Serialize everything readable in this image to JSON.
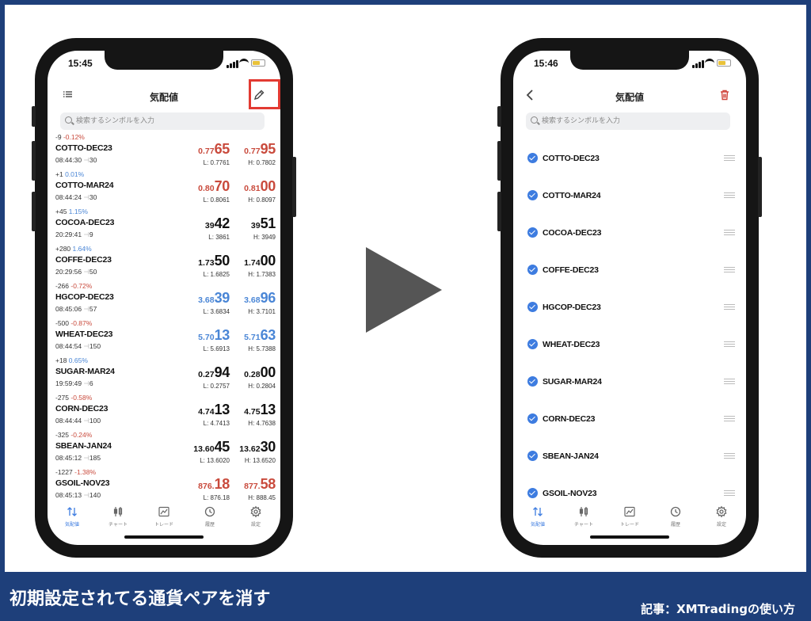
{
  "bottom_title": "初期設定されてる通貨ペアを消す",
  "credit": "記事：XMTradingの使い方",
  "colors": {
    "frame": "#1e3f7a",
    "red": "#c94a3c",
    "blue": "#4a86d6",
    "highlight": "#e23a32",
    "check": "#3d7ce0"
  },
  "left_phone": {
    "time": "15:45",
    "title": "気配値",
    "menu_icon": "list-icon",
    "edit_icon": "pencil-icon",
    "search_placeholder": "検索するシンボルを入力",
    "quotes": [
      {
        "pts": "-9",
        "pct": "-0.12%",
        "pct_color": "red",
        "symbol": "COTTO-DEC23",
        "time": "08:44:30",
        "spread": "30",
        "bid_small": "0.77",
        "bid_big": "65",
        "ask_small": "0.77",
        "ask_big": "95",
        "price_color": "red",
        "low": "L: 0.7761",
        "high": "H: 0.7802"
      },
      {
        "pts": "+1",
        "pct": "0.01%",
        "pct_color": "blue",
        "symbol": "COTTO-MAR24",
        "time": "08:44:24",
        "spread": "30",
        "bid_small": "0.80",
        "bid_big": "70",
        "ask_small": "0.81",
        "ask_big": "00",
        "price_color": "red",
        "low": "L: 0.8061",
        "high": "H: 0.8097"
      },
      {
        "pts": "+45",
        "pct": "1.15%",
        "pct_color": "blue",
        "symbol": "COCOA-DEC23",
        "time": "20:29:41",
        "spread": "9",
        "bid_small": "39",
        "bid_big": "42",
        "ask_small": "39",
        "ask_big": "51",
        "price_color": "black",
        "low": "L: 3861",
        "high": "H: 3949"
      },
      {
        "pts": "+280",
        "pct": "1.64%",
        "pct_color": "blue",
        "symbol": "COFFE-DEC23",
        "time": "20:29:56",
        "spread": "50",
        "bid_small": "1.73",
        "bid_big": "50",
        "ask_small": "1.74",
        "ask_big": "00",
        "price_color": "black",
        "low": "L: 1.6825",
        "high": "H: 1.7383"
      },
      {
        "pts": "-266",
        "pct": "-0.72%",
        "pct_color": "red",
        "symbol": "HGCOP-DEC23",
        "time": "08:45:06",
        "spread": "57",
        "bid_small": "3.68",
        "bid_big": "39",
        "ask_small": "3.68",
        "ask_big": "96",
        "price_color": "blue",
        "low": "L: 3.6834",
        "high": "H: 3.7101"
      },
      {
        "pts": "-500",
        "pct": "-0.87%",
        "pct_color": "red",
        "symbol": "WHEAT-DEC23",
        "time": "08:44:54",
        "spread": "150",
        "bid_small": "5.70",
        "bid_big": "13",
        "ask_small": "5.71",
        "ask_big": "63",
        "price_color": "blue",
        "low": "L: 5.6913",
        "high": "H: 5.7388"
      },
      {
        "pts": "+18",
        "pct": "0.65%",
        "pct_color": "blue",
        "symbol": "SUGAR-MAR24",
        "time": "19:59:49",
        "spread": "6",
        "bid_small": "0.27",
        "bid_big": "94",
        "ask_small": "0.28",
        "ask_big": "00",
        "price_color": "black",
        "low": "L: 0.2757",
        "high": "H: 0.2804"
      },
      {
        "pts": "-275",
        "pct": "-0.58%",
        "pct_color": "red",
        "symbol": "CORN-DEC23",
        "time": "08:44:44",
        "spread": "100",
        "bid_small": "4.74",
        "bid_big": "13",
        "ask_small": "4.75",
        "ask_big": "13",
        "price_color": "black",
        "low": "L: 4.7413",
        "high": "H: 4.7638"
      },
      {
        "pts": "-325",
        "pct": "-0.24%",
        "pct_color": "red",
        "symbol": "SBEAN-JAN24",
        "time": "08:45:12",
        "spread": "185",
        "bid_small": "13.60",
        "bid_big": "45",
        "ask_small": "13.62",
        "ask_big": "30",
        "price_color": "black",
        "low": "L: 13.6020",
        "high": "H: 13.6520"
      },
      {
        "pts": "-1227",
        "pct": "-1.38%",
        "pct_color": "red",
        "symbol": "GSOIL-NOV23",
        "time": "08:45:13",
        "spread": "140",
        "bid_small": "876.",
        "bid_big": "18",
        "ask_small": "877.",
        "ask_big": "58",
        "price_color": "red",
        "low": "L: 876.18",
        "high": "H: 888.45"
      }
    ]
  },
  "right_phone": {
    "time": "15:46",
    "title": "気配値",
    "back_icon": "chevron-left-icon",
    "delete_icon": "trash-icon",
    "search_placeholder": "検索するシンボルを入力",
    "symbols": [
      "COTTO-DEC23",
      "COTTO-MAR24",
      "COCOA-DEC23",
      "COFFE-DEC23",
      "HGCOP-DEC23",
      "WHEAT-DEC23",
      "SUGAR-MAR24",
      "CORN-DEC23",
      "SBEAN-JAN24",
      "GSOIL-NOV23"
    ]
  },
  "tabs": [
    {
      "label": "気配値",
      "icon": "arrows-updown-icon",
      "active": true
    },
    {
      "label": "チャート",
      "icon": "candlestick-icon",
      "active": false
    },
    {
      "label": "トレード",
      "icon": "trade-chart-icon",
      "active": false
    },
    {
      "label": "履歴",
      "icon": "history-icon",
      "active": false
    },
    {
      "label": "設定",
      "icon": "gear-icon",
      "active": false
    }
  ]
}
